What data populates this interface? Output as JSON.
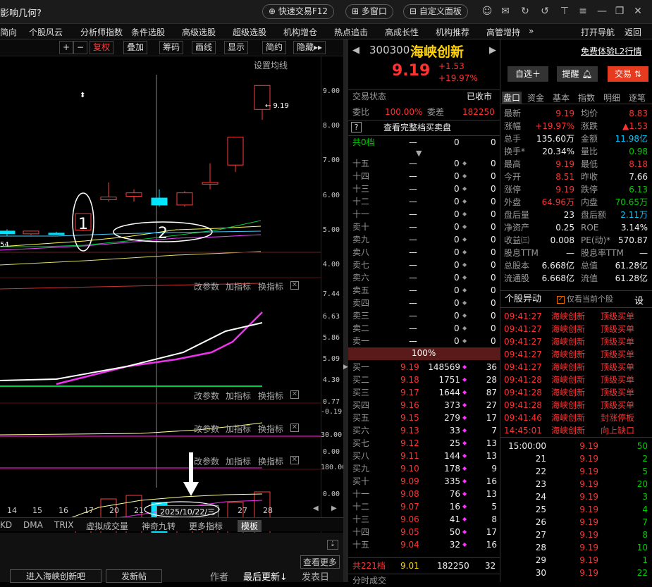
{
  "title": "影响几何?",
  "titlebar": {
    "quick_trade": "快速交易F12",
    "multi_window": "多窗口",
    "custom_panel": "自定义面板"
  },
  "menu": [
    "简向",
    "个股风云",
    "分析师指数",
    "条件选股",
    "高级选股",
    "超级选股",
    "机构增仓",
    "热点追击",
    "高成长性",
    "机构推荐",
    "高管增持",
    "»",
    "打开导航",
    "返回"
  ],
  "charttool": {
    "plus": "+",
    "minus": "−",
    "fuquan": "复权",
    "overlay": "叠加",
    "chouma": "筹码",
    "draw": "画线",
    "display": "显示",
    "simple": "简约",
    "hide": "隐藏▸▸",
    "setma": "设置均线"
  },
  "chart_data": [
    {
      "type": "candlestick",
      "title": "",
      "y_ticks": [
        4.0,
        5.0,
        6.0,
        7.0,
        8.0,
        9.0
      ],
      "ylim": [
        3.7,
        9.5
      ],
      "high_annotation": "9.19",
      "low_annotation": "54",
      "candles": [
        {
          "o": 5.0,
          "h": 5.05,
          "l": 4.85,
          "c": 4.92,
          "dir": "down"
        },
        {
          "o": 4.92,
          "h": 5.0,
          "l": 4.88,
          "c": 5.0,
          "dir": "up"
        },
        {
          "o": 4.94,
          "h": 4.98,
          "l": 4.9,
          "c": 4.94,
          "dir": "flat"
        },
        {
          "o": 5.03,
          "h": 5.5,
          "l": 5.0,
          "c": 5.5,
          "dir": "up"
        },
        {
          "o": 5.9,
          "h": 6.4,
          "l": 5.85,
          "c": 5.98,
          "dir": "up"
        },
        {
          "o": 6.0,
          "h": 6.2,
          "l": 5.85,
          "c": 6.1,
          "dir": "up"
        },
        {
          "o": 5.95,
          "h": 6.2,
          "l": 5.7,
          "c": 5.75,
          "dir": "down"
        },
        {
          "o": 5.75,
          "h": 6.15,
          "l": 5.7,
          "c": 6.1,
          "dir": "up"
        },
        {
          "o": 6.35,
          "h": 6.95,
          "l": 6.2,
          "c": 6.4,
          "dir": "up"
        },
        {
          "o": 6.9,
          "h": 7.7,
          "l": 6.7,
          "c": 7.7,
          "dir": "up"
        },
        {
          "o": 8.5,
          "h": 9.19,
          "l": 8.2,
          "c": 9.19,
          "dir": "up"
        }
      ],
      "annotations": [
        "1",
        "2"
      ]
    },
    {
      "type": "line",
      "title": "",
      "y_ticks": [
        4.3,
        5.09,
        5.86,
        6.63,
        7.44
      ]
    },
    {
      "type": "line",
      "title": "",
      "y_ticks": [
        -0.19,
        0.77
      ]
    },
    {
      "type": "line",
      "title": "",
      "y_ticks": [
        0.0,
        30.0
      ]
    },
    {
      "type": "bar",
      "title": "",
      "y_ticks": [
        0.0,
        180.0
      ]
    }
  ],
  "panel_tools": {
    "params": "改参数",
    "indicator": "加指标",
    "switch": "换指标"
  },
  "xaxis": {
    "ticks": [
      "14",
      "15",
      "16",
      "17",
      "20",
      "21",
      "27",
      "28"
    ],
    "cursor_date": "2025/10/22/三"
  },
  "bottom_tabs": [
    "KD",
    "DMA",
    "TRIX",
    "虚拟成交量",
    "神奇九转",
    "更多指标",
    "模板"
  ],
  "forum": {
    "more": "查看更多",
    "enter": "进入海峡创新吧",
    "post": "发新帖",
    "author": "作者",
    "last_update": "最后更新↓",
    "publish": "发表日"
  },
  "stock": {
    "code": "300300",
    "name": "海峡创新",
    "price": "9.19",
    "change": "+1.53",
    "pct": "+19.97%",
    "l2": "免费体验L2行情",
    "zixuan": "自选＋",
    "alert": "提醒",
    "trade": "交易"
  },
  "trade_status": {
    "label": "交易状态",
    "value": "已收市",
    "weibi_label": "委比",
    "weibi": "100.00%",
    "weicha_label": "委差",
    "weicha": "182250",
    "fullbook": "查看完整档买卖盘",
    "total_label": "共0档",
    "total_a": "—",
    "total_b": "0",
    "total_c": "0"
  },
  "asks": [
    {
      "l": "十五"
    },
    {
      "l": "十四"
    },
    {
      "l": "十三"
    },
    {
      "l": "十二"
    },
    {
      "l": "十一"
    },
    {
      "l": "卖十"
    },
    {
      "l": "卖九"
    },
    {
      "l": "卖八"
    },
    {
      "l": "卖七"
    },
    {
      "l": "卖六"
    },
    {
      "l": "卖五"
    },
    {
      "l": "卖四"
    },
    {
      "l": "卖三"
    },
    {
      "l": "卖二"
    },
    {
      "l": "卖一"
    }
  ],
  "ask_dash": "—",
  "ask_zero": "0",
  "ratio_bar": "100%",
  "bids": [
    {
      "l": "买一",
      "p": "9.19",
      "v": "148569",
      "n": "36"
    },
    {
      "l": "买二",
      "p": "9.18",
      "v": "1751",
      "n": "28"
    },
    {
      "l": "买三",
      "p": "9.17",
      "v": "1644",
      "n": "87"
    },
    {
      "l": "买四",
      "p": "9.16",
      "v": "373",
      "n": "27"
    },
    {
      "l": "买五",
      "p": "9.15",
      "v": "279",
      "n": "17"
    },
    {
      "l": "买六",
      "p": "9.13",
      "v": "33",
      "n": "7"
    },
    {
      "l": "买七",
      "p": "9.12",
      "v": "25",
      "n": "13"
    },
    {
      "l": "买八",
      "p": "9.11",
      "v": "144",
      "n": "13"
    },
    {
      "l": "买九",
      "p": "9.10",
      "v": "178",
      "n": "9"
    },
    {
      "l": "买十",
      "p": "9.09",
      "v": "335",
      "n": "16"
    },
    {
      "l": "十一",
      "p": "9.08",
      "v": "76",
      "n": "13"
    },
    {
      "l": "十二",
      "p": "9.07",
      "v": "16",
      "n": "5"
    },
    {
      "l": "十三",
      "p": "9.06",
      "v": "41",
      "n": "8"
    },
    {
      "l": "十四",
      "p": "9.05",
      "v": "50",
      "n": "17"
    },
    {
      "l": "十五",
      "p": "9.04",
      "v": "32",
      "n": "16"
    }
  ],
  "bid_total": {
    "l": "共221档",
    "p": "9.01",
    "v": "182250",
    "n": "32"
  },
  "tick_header": "分时成交",
  "rtabs": [
    "盘口",
    "资金",
    "基本",
    "指数",
    "明细",
    "逐笔"
  ],
  "quote": [
    {
      "a": "最新",
      "av": "9.19",
      "b": "均价",
      "bv": "8.83",
      "ac": "red",
      "bc": "red"
    },
    {
      "a": "涨幅",
      "av": "+19.97%",
      "b": "涨跌",
      "bv": "▲1.53",
      "ac": "red",
      "bc": "red"
    },
    {
      "a": "总手",
      "av": "135.60万",
      "b": "金额",
      "bv": "11.98亿",
      "ac": "white",
      "bc": "cyan"
    },
    {
      "a": "换手*",
      "av": "20.34%",
      "b": "量比",
      "bv": "0.98",
      "ac": "white",
      "bc": "green"
    },
    {
      "a": "最高",
      "av": "9.19",
      "b": "最低",
      "bv": "8.18",
      "ac": "red",
      "bc": "red"
    },
    {
      "a": "今开",
      "av": "8.51",
      "b": "昨收",
      "bv": "7.66",
      "ac": "red",
      "bc": "white"
    },
    {
      "a": "涨停",
      "av": "9.19",
      "b": "跌停",
      "bv": "6.13",
      "ac": "red",
      "bc": "green"
    },
    {
      "a": "外盘",
      "av": "64.96万",
      "b": "内盘",
      "bv": "70.65万",
      "ac": "red",
      "bc": "green"
    },
    {
      "a": "盘后量",
      "av": "23",
      "b": "盘后额",
      "bv": "2.11万",
      "ac": "white",
      "bc": "cyan"
    },
    {
      "a": "净资产",
      "av": "0.25",
      "b": "ROE",
      "bv": "3.14%",
      "ac": "white",
      "bc": "white"
    },
    {
      "a": "收益㈢",
      "av": "0.008",
      "b": "PE(动)*",
      "bv": "570.87",
      "ac": "white",
      "bc": "white"
    },
    {
      "a": "股息TTM",
      "av": "—",
      "b": "股息率TTM",
      "bv": "—",
      "ac": "white",
      "bc": "white"
    },
    {
      "a": "总股本",
      "av": "6.668亿",
      "b": "总值",
      "bv": "61.28亿",
      "ac": "white",
      "bc": "white"
    },
    {
      "a": "流通股",
      "av": "6.668亿",
      "b": "流值",
      "bv": "61.28亿",
      "ac": "white",
      "bc": "white"
    }
  ],
  "moves": {
    "title": "个股异动",
    "only_current": "仅看当前个股",
    "settings": "设",
    "rows": [
      {
        "t": "09:41:27",
        "n": "海峡创新",
        "e": "顶级买单"
      },
      {
        "t": "09:41:27",
        "n": "海峡创新",
        "e": "顶级买单"
      },
      {
        "t": "09:41:27",
        "n": "海峡创新",
        "e": "顶级买单"
      },
      {
        "t": "09:41:27",
        "n": "海峡创新",
        "e": "顶级买单"
      },
      {
        "t": "09:41:27",
        "n": "海峡创新",
        "e": "顶级买单"
      },
      {
        "t": "09:41:28",
        "n": "海峡创新",
        "e": "顶级买单"
      },
      {
        "t": "09:41:28",
        "n": "海峡创新",
        "e": "顶级买单"
      },
      {
        "t": "09:41:28",
        "n": "海峡创新",
        "e": "顶级买单"
      },
      {
        "t": "09:41:46",
        "n": "海峡创新",
        "e": "封涨停板"
      },
      {
        "t": "14:45:01",
        "n": "海峡创新",
        "e": "向上缺口"
      }
    ]
  },
  "ticks": [
    {
      "t": "15:00:00",
      "p": "9.19",
      "v": "50"
    },
    {
      "t": "21",
      "p": "9.19",
      "v": "2"
    },
    {
      "t": "22",
      "p": "9.19",
      "v": "5"
    },
    {
      "t": "23",
      "p": "9.19",
      "v": "20"
    },
    {
      "t": "24",
      "p": "9.19",
      "v": "3"
    },
    {
      "t": "25",
      "p": "9.19",
      "v": "4"
    },
    {
      "t": "26",
      "p": "9.19",
      "v": "7"
    },
    {
      "t": "27",
      "p": "9.19",
      "v": "8"
    },
    {
      "t": "28",
      "p": "9.19",
      "v": "10"
    },
    {
      "t": "29",
      "p": "9.19",
      "v": "1"
    },
    {
      "t": "30",
      "p": "9.19",
      "v": "22"
    }
  ]
}
